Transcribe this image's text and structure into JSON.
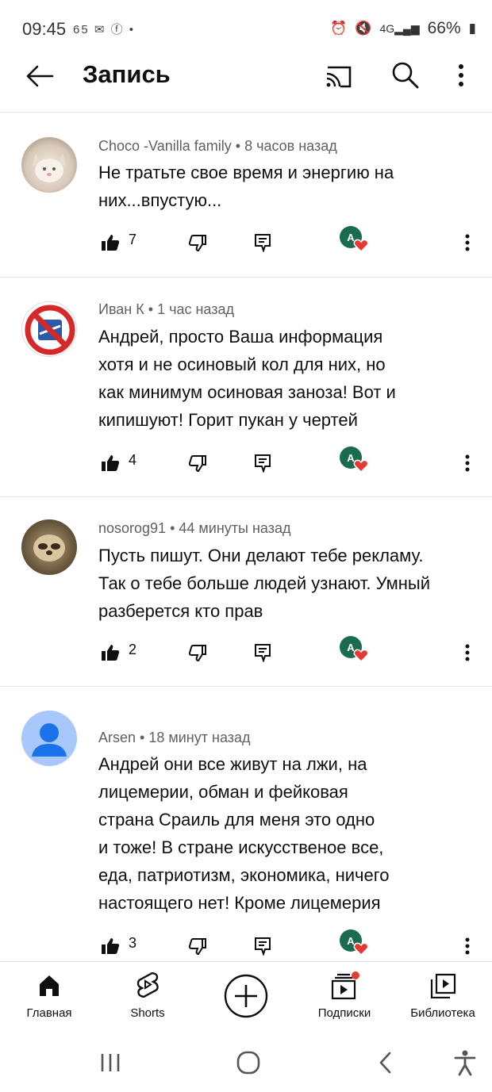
{
  "status_bar": {
    "time": "09:45",
    "left_icons": "65 ✉ ⓕ •",
    "battery": "66%"
  },
  "app_bar": {
    "title": "Запись",
    "back_icon": "arrow-left-icon",
    "cast_icon": "cast-icon",
    "search_icon": "search-icon",
    "more_icon": "more-vert-icon"
  },
  "comments": [
    {
      "author": "Choco -Vanilla family",
      "time": "8 часов назад",
      "text_lines": [
        "Не тратьте свое время и энергию на",
        "них...впустую..."
      ],
      "likes": "7",
      "avatar_color": "#c9b8a8"
    },
    {
      "author": "Иван К",
      "time": "1 час назад",
      "text_lines": [
        "Андрей, просто Ваша информация",
        "хотя и не осиновый кол для них, но",
        "как минимум осиновая заноза! Вот и",
        "кипишуют! Горит пукан у чертей"
      ],
      "likes": "4",
      "avatar_color": "#d62828"
    },
    {
      "author": "nosorog91",
      "time": "44 минуты назад",
      "text_lines": [
        "Пусть пишут. Они  делают тебе рекламу.",
        "Так о тебе больше людей узнают. Умный",
        "разберется кто прав"
      ],
      "likes": "2",
      "avatar_color": "#6b5a3e"
    },
    {
      "author": "Arsen",
      "time": "18 минут назад",
      "text_lines": [
        "Андрей они все живут на лжи, на",
        "лицемерии, обман и фейковая",
        "страна Сраиль для меня это одно",
        "и тоже! В стране искусственое все,",
        "еда, патриотизм, экономика, ничего",
        "настоящего нет! Кроме лицемерия"
      ],
      "likes": "3",
      "avatar_color": "#a8c7fa"
    }
  ],
  "creator_badge_letter": "А",
  "bottom_nav": {
    "home": "Главная",
    "shorts": "Shorts",
    "subscriptions": "Подписки",
    "library": "Библиотека"
  },
  "colors": {
    "text": "#0f0f0f",
    "meta": "#606060",
    "divider": "#e3e3e3",
    "heart": "#e53935",
    "creator_badge": "#1a6b4f",
    "notification_dot": "#e53935"
  }
}
